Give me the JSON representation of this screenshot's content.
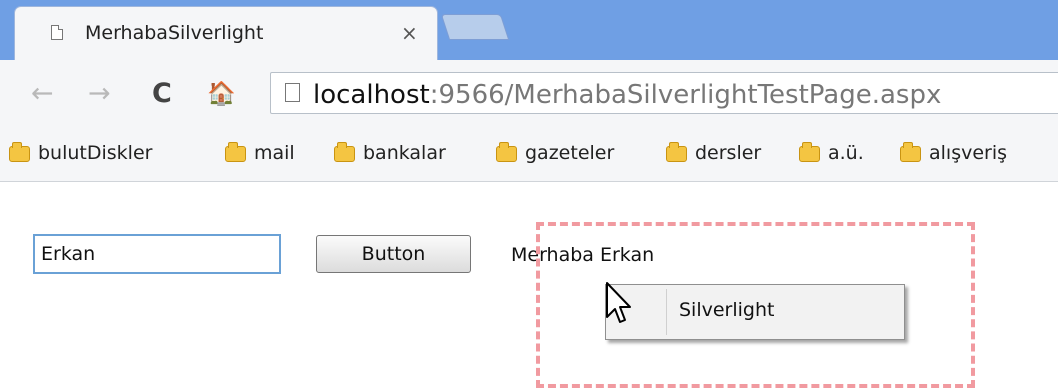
{
  "tab": {
    "title": "MerhabaSilverlight",
    "close_label": "×"
  },
  "toolbar": {
    "back_glyph": "←",
    "forward_glyph": "→",
    "reload_glyph": "C",
    "home_glyph": "🏠",
    "url_host": "localhost",
    "url_rest": ":9566/MerhabaSilverlightTestPage.aspx"
  },
  "bookmarks": [
    "bulutDiskler",
    "mail",
    "bankalar",
    "gazeteler",
    "dersler",
    "a.ü.",
    "alışveriş"
  ],
  "page": {
    "textbox_value": "Erkan",
    "button_label": "Button",
    "greeting": "Merhaba Erkan"
  },
  "context_menu": {
    "items": [
      "Silverlight"
    ]
  },
  "colors": {
    "tabstrip": "#6f9fe4",
    "textbox_border": "#6aa1d6",
    "plugin_frame_dash": "#f19aa0",
    "folder": "#f4c542"
  },
  "icons": {
    "favicon": "page-icon",
    "bookmark_item": "folder-icon",
    "pointer": "mouse-cursor-icon"
  }
}
